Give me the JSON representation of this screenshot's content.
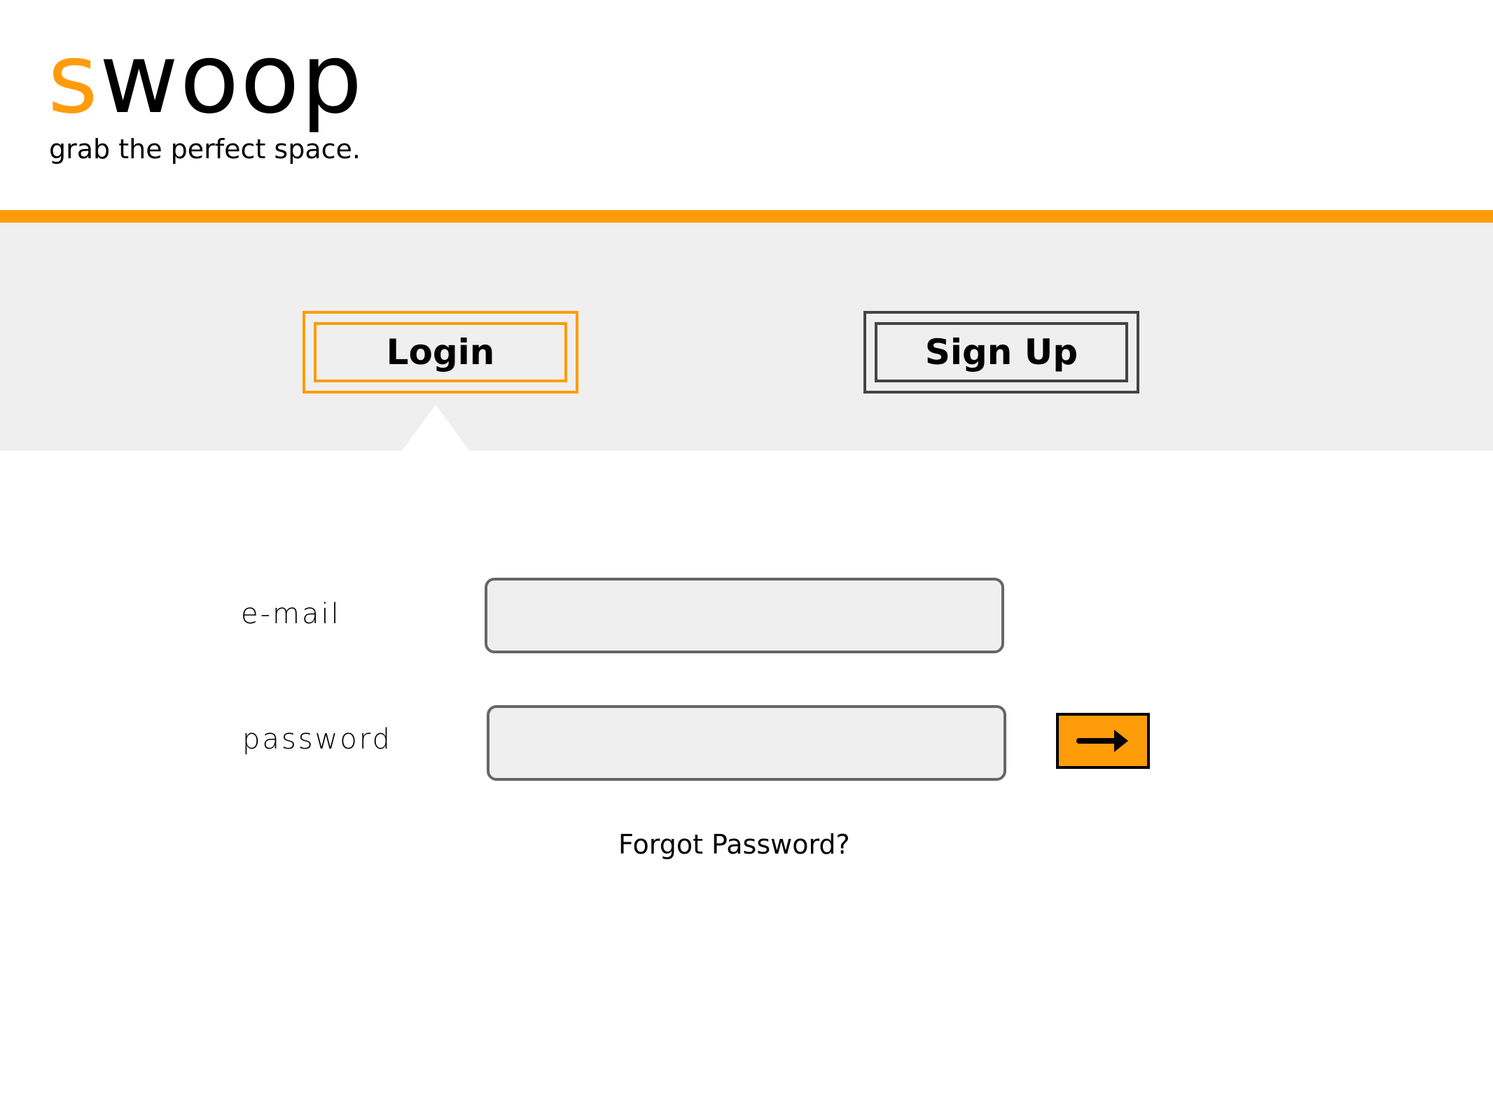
{
  "brand": {
    "logo_first_letter": "s",
    "logo_rest": "woop",
    "tagline": "grab the perfect space."
  },
  "tabs": {
    "login_label": "Login",
    "signup_label": "Sign Up",
    "active": "login"
  },
  "form": {
    "email_label": "e-mail",
    "email_value": "",
    "password_label": "password",
    "password_value": "",
    "submit_icon": "arrow-right-icon",
    "forgot_password_label": "Forgot Password?"
  },
  "colors": {
    "accent": "#ff9c0a",
    "band_background": "#efefef",
    "input_background": "#efefef",
    "input_border": "#666666",
    "signup_border": "#444444",
    "text": "#000000"
  }
}
